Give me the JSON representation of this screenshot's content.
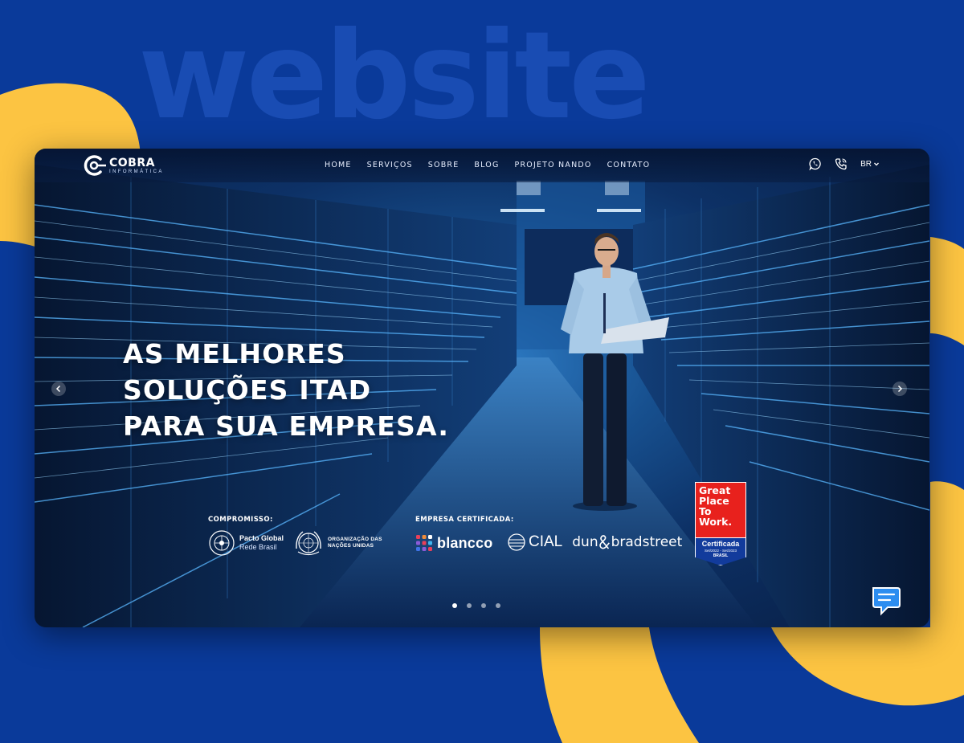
{
  "background": {
    "word": "website",
    "colors": {
      "blue": "#0a3a9a",
      "yellow": "#fcc442",
      "word": "#1c50b8"
    }
  },
  "brand": {
    "name": "COBRA",
    "subtitle": "INFORMÁTICA"
  },
  "nav": {
    "items": [
      "HOME",
      "SERVIÇOS",
      "SOBRE",
      "BLOG",
      "PROJETO NANDO",
      "CONTATO"
    ],
    "language": "BR",
    "icons": [
      "whatsapp-icon",
      "phone-icon",
      "chevron-down-icon"
    ]
  },
  "hero": {
    "title_lines": [
      "AS MELHORES",
      "SOLUÇÕES ITAD",
      "PARA SUA EMPRESA."
    ]
  },
  "commitment": {
    "label": "COMPROMISSO:",
    "pacto_name": "Pacto Global",
    "pacto_sub": "Rede Brasil",
    "onu_line1": "ORGANIZAÇÃO DAS",
    "onu_line2": "NAÇÕES UNIDAS"
  },
  "certified": {
    "label": "EMPRESA CERTIFICADA:",
    "blancco": "blancco",
    "cial": "CIAL",
    "dnb_left": "dun",
    "dnb_right": "bradstreet"
  },
  "gptw": {
    "lines": [
      "Great",
      "Place",
      "To",
      "Work."
    ],
    "certified": "Certificada",
    "period": "Set/2022 - Set/2023",
    "country": "BRASIL",
    "color": "#e8211d"
  },
  "carousel": {
    "slide_count": 4,
    "active_index": 0
  }
}
